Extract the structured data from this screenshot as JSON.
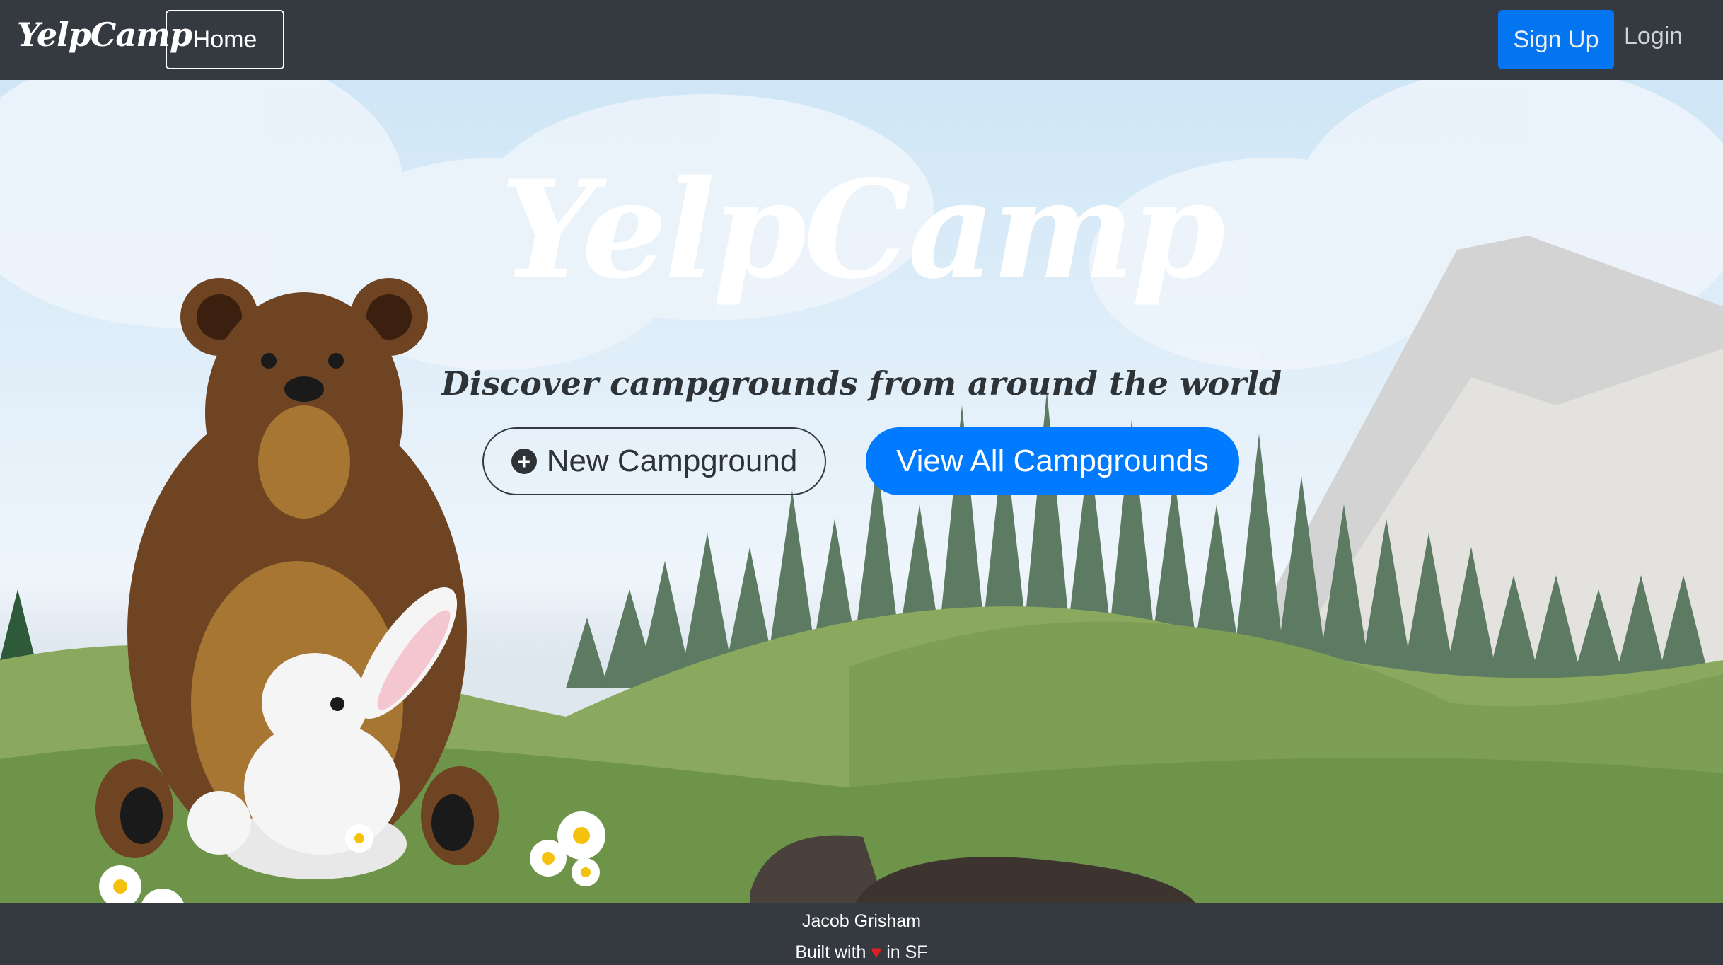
{
  "navbar": {
    "brand": "YelpCamp",
    "home_label": "Home",
    "signup_label": "Sign Up",
    "login_label": "Login"
  },
  "hero": {
    "title": "YelpCamp",
    "subtitle": "Discover campgrounds from around the world",
    "new_campground_label": "New Campground",
    "new_campground_icon": "plus-circle-icon",
    "view_all_label": "View All Campgrounds"
  },
  "footer": {
    "author": "Jacob Grisham",
    "built_prefix": "Built with",
    "heart_icon": "heart-icon",
    "built_suffix": "in SF"
  },
  "colors": {
    "navbar_bg": "#343a40",
    "primary": "#007bff",
    "heart": "#e02020"
  }
}
